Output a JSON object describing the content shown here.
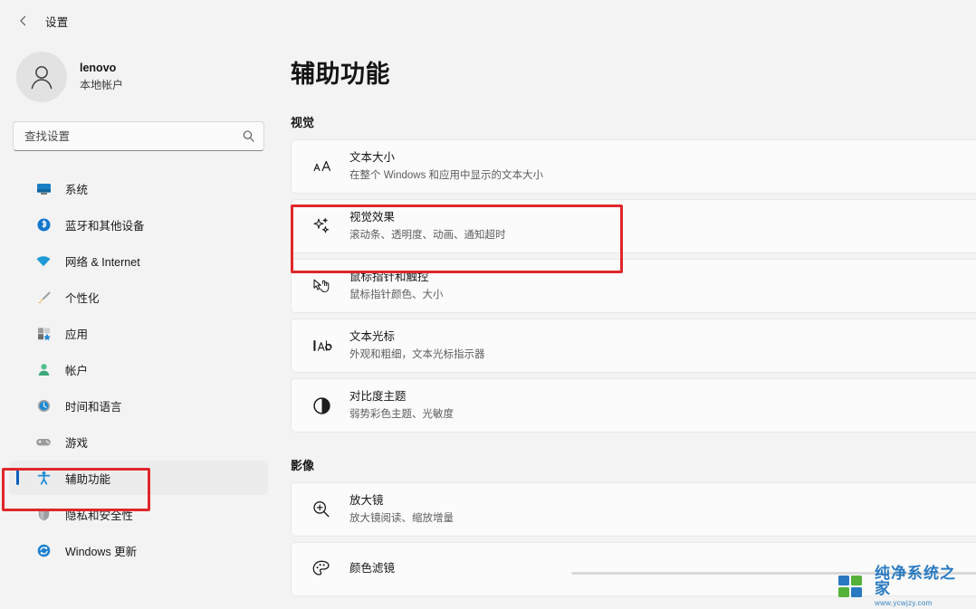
{
  "window": {
    "back_icon": "back-arrow-icon",
    "title": "设置"
  },
  "sidebar": {
    "account": {
      "avatar_icon": "person-avatar-icon",
      "name": "lenovo",
      "type": "本地帐户"
    },
    "search": {
      "placeholder": "查找设置",
      "value": "",
      "icon": "search-icon"
    },
    "items": [
      {
        "label": "系统",
        "icon": "system-icon",
        "selected": false
      },
      {
        "label": "蓝牙和其他设备",
        "icon": "bluetooth-icon",
        "selected": false
      },
      {
        "label": "网络 & Internet",
        "icon": "network-wifi-icon",
        "selected": false
      },
      {
        "label": "个性化",
        "icon": "personalization-brush-icon",
        "selected": false
      },
      {
        "label": "应用",
        "icon": "apps-icon",
        "selected": false
      },
      {
        "label": "帐户",
        "icon": "accounts-person-icon",
        "selected": false
      },
      {
        "label": "时间和语言",
        "icon": "time-language-clock-icon",
        "selected": false
      },
      {
        "label": "游戏",
        "icon": "gaming-controller-icon",
        "selected": false
      },
      {
        "label": "辅助功能",
        "icon": "accessibility-icon",
        "selected": true
      },
      {
        "label": "隐私和安全性",
        "icon": "privacy-shield-icon",
        "selected": false
      },
      {
        "label": "Windows 更新",
        "icon": "windows-update-icon",
        "selected": false
      }
    ]
  },
  "main": {
    "page_title": "辅助功能",
    "sections": [
      {
        "heading": "视觉",
        "cards": [
          {
            "title": "文本大小",
            "subtitle": "在整个 Windows 和应用中显示的文本大小",
            "icon": "text-size-aa-icon",
            "highlighted": false
          },
          {
            "title": "视觉效果",
            "subtitle": "滚动条、透明度、动画、通知超时",
            "icon": "visual-effects-sparkle-icon",
            "highlighted": true
          },
          {
            "title": "鼠标指针和触控",
            "subtitle": "鼠标指针颜色、大小",
            "icon": "mouse-pointer-touch-icon",
            "highlighted": false
          },
          {
            "title": "文本光标",
            "subtitle": "外观和粗细，文本光标指示器",
            "icon": "text-cursor-icon",
            "highlighted": false
          },
          {
            "title": "对比度主题",
            "subtitle": "弱势彩色主题、光敏度",
            "icon": "contrast-theme-icon",
            "highlighted": false
          }
        ]
      },
      {
        "heading": "影像",
        "cards": [
          {
            "title": "放大镜",
            "subtitle": "放大镜阅读、缩放增量",
            "icon": "magnifier-icon",
            "highlighted": false
          },
          {
            "title": "颜色滤镜",
            "subtitle": "",
            "icon": "color-filters-palette-icon",
            "highlighted": false
          }
        ]
      }
    ]
  },
  "annotations": {
    "highlight_color": "#e0272b",
    "selected_indicator_color": "#0e5fbf"
  },
  "watermark": {
    "brand": "纯净系统之家",
    "url": "www.ycwjzy.com",
    "colors": {
      "blue": "#1e73be",
      "green": "#4caf2f"
    }
  }
}
